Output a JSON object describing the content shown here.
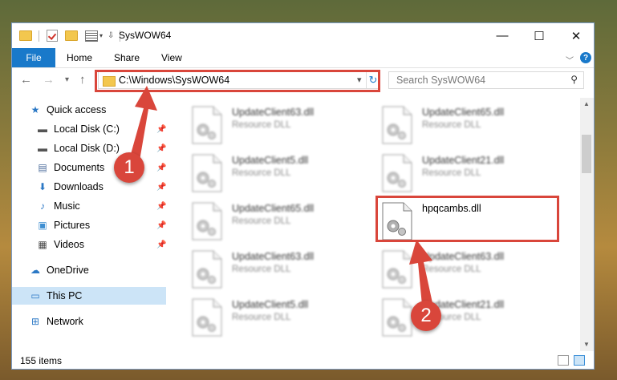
{
  "window": {
    "title": "SysWOW64",
    "min_glyph": "—",
    "max_glyph": "☐",
    "close_glyph": "✕"
  },
  "ribbon": {
    "file": "File",
    "tabs": [
      "Home",
      "Share",
      "View"
    ],
    "help": "?"
  },
  "navbar": {
    "back": "←",
    "forward": "→",
    "recent": "▾",
    "up": "↑",
    "address": "C:\\Windows\\SysWOW64",
    "dropdown": "▾",
    "refresh": "↻",
    "search_placeholder": "Search SysWOW64",
    "search_icon": "⚲"
  },
  "sidebar": {
    "items": [
      {
        "label": "Quick access",
        "icon": "star-icon",
        "glyph": "★",
        "color": "#2b78c5"
      },
      {
        "label": "Local Disk (C:)",
        "icon": "drive-icon",
        "glyph": "▬",
        "color": "#555555",
        "pinned": true
      },
      {
        "label": "Local Disk (D:)",
        "icon": "drive-icon",
        "glyph": "▬",
        "color": "#555555",
        "pinned": true
      },
      {
        "label": "Documents",
        "icon": "documents-icon",
        "glyph": "▤",
        "color": "#4a6a9a",
        "pinned": true
      },
      {
        "label": "Downloads",
        "icon": "downloads-icon",
        "glyph": "⬇",
        "color": "#2b78c5",
        "pinned": true
      },
      {
        "label": "Music",
        "icon": "music-icon",
        "glyph": "♪",
        "color": "#2b78c5",
        "pinned": true
      },
      {
        "label": "Pictures",
        "icon": "pictures-icon",
        "glyph": "▣",
        "color": "#3f8fd2",
        "pinned": true
      },
      {
        "label": "Videos",
        "icon": "videos-icon",
        "glyph": "▦",
        "color": "#444444",
        "pinned": true
      },
      {
        "label": "OneDrive",
        "icon": "onedrive-icon",
        "glyph": "☁",
        "color": "#2b78c5"
      },
      {
        "label": "This PC",
        "icon": "this-pc-icon",
        "glyph": "▭",
        "color": "#2b78c5",
        "selected": true
      },
      {
        "label": "Network",
        "icon": "network-icon",
        "glyph": "⊞",
        "color": "#2b78c5"
      }
    ],
    "pin_glyph": "📌"
  },
  "files": [
    {
      "name": "UpdateClient63.dll",
      "type": "Resource DLL"
    },
    {
      "name": "UpdateClient65.dll",
      "type": "Resource DLL"
    },
    {
      "name": "UpdateClient5.dll",
      "type": "Resource DLL"
    },
    {
      "name": "UpdateClient21.dll",
      "type": "Resource DLL"
    },
    {
      "name": "UpdateClient65.dll",
      "type": "Resource DLL"
    },
    {
      "name": "hpqcambs.dll",
      "type": ""
    },
    {
      "name": "UpdateClient63.dll",
      "type": "Resource DLL"
    },
    {
      "name": "UpdateClient63.dll",
      "type": "Resource DLL"
    },
    {
      "name": "UpdateClient5.dll",
      "type": "Resource DLL"
    },
    {
      "name": "UpdateClient21.dll",
      "type": "Resource DLL"
    }
  ],
  "status": {
    "count": "155 items"
  },
  "callouts": [
    {
      "number": "1"
    },
    {
      "number": "2"
    }
  ],
  "colors": {
    "accent": "#1979ca",
    "highlight": "#d9463b",
    "selection": "#cce4f7"
  }
}
